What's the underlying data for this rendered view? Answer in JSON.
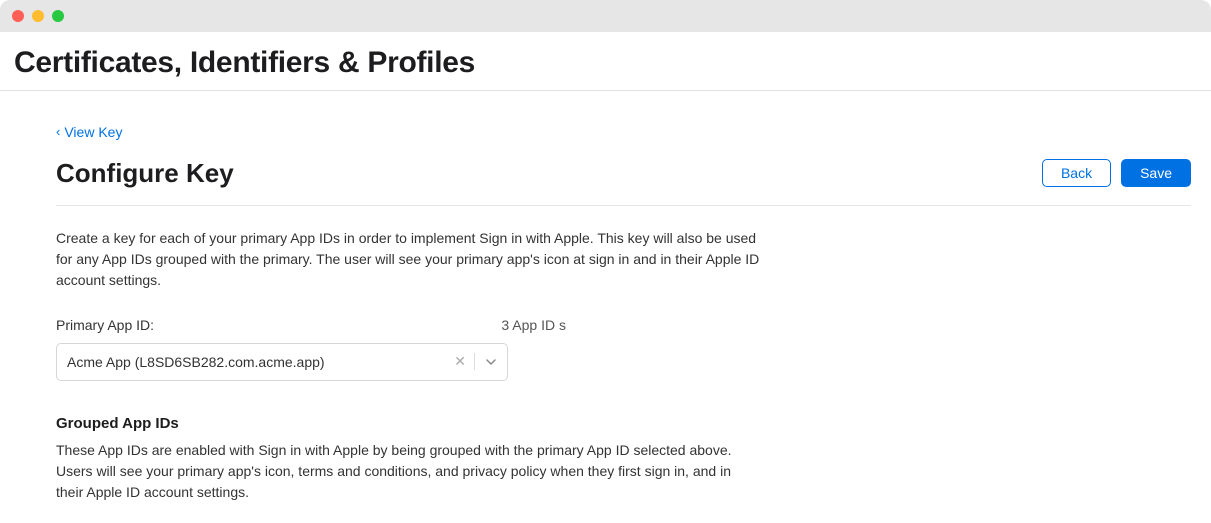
{
  "breadcrumbTitle": "Certificates, Identifiers & Profiles",
  "backLink": "View Key",
  "sectionTitle": "Configure Key",
  "buttons": {
    "back": "Back",
    "save": "Save"
  },
  "description": "Create a key for each of your primary App IDs in order to implement Sign in with Apple. This key will also be used for any App IDs grouped with the primary. The user will see your primary app's icon at sign in and in their Apple ID account settings.",
  "primaryAppId": {
    "label": "Primary App ID:",
    "count": "3 App ID s",
    "selected": "Acme App (L8SD6SB282.com.acme.app)"
  },
  "groupedAppIds": {
    "title": "Grouped App IDs",
    "description": "These App IDs are enabled with Sign in with Apple by being grouped with the primary App ID selected above. Users will see your primary app's icon, terms and conditions, and privacy policy when they first sign in, and in their Apple ID account settings."
  }
}
